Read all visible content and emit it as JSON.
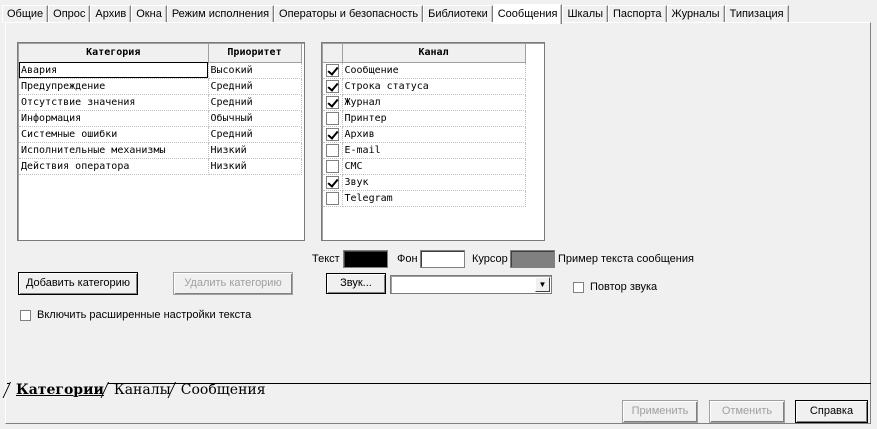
{
  "top_tabs": [
    "Общие",
    "Опрос",
    "Архив",
    "Окна",
    "Режим исполнения",
    "Операторы и безопасность",
    "Библиотеки",
    "Сообщения",
    "Шкалы",
    "Паспорта",
    "Журналы",
    "Типизация"
  ],
  "active_tab_index": 7,
  "category_grid": {
    "headers": {
      "category": "Категория",
      "priority": "Приоритет"
    },
    "rows": [
      {
        "category": "Авария",
        "priority": "Высокий"
      },
      {
        "category": "Предупреждение",
        "priority": "Средний"
      },
      {
        "category": "Отсутствие значения",
        "priority": "Средний"
      },
      {
        "category": "Информация",
        "priority": "Обычный"
      },
      {
        "category": "Системные ошибки",
        "priority": "Средний"
      },
      {
        "category": "Исполнительные механизмы",
        "priority": "Низкий"
      },
      {
        "category": "Действия оператора",
        "priority": "Низкий"
      }
    ]
  },
  "channel_grid": {
    "header": "Канал",
    "rows": [
      {
        "name": "Сообщение",
        "checked": true
      },
      {
        "name": "Строка статуса",
        "checked": true
      },
      {
        "name": "Журнал",
        "checked": true
      },
      {
        "name": "Принтер",
        "checked": false
      },
      {
        "name": "Архив",
        "checked": true
      },
      {
        "name": "E-mail",
        "checked": false
      },
      {
        "name": "СМС",
        "checked": false
      },
      {
        "name": "Звук",
        "checked": true
      },
      {
        "name": "Telegram",
        "checked": false
      }
    ]
  },
  "colors": {
    "text_label": "Текст",
    "text_color": "#000000",
    "bg_label": "Фон",
    "bg_color": "#ffffff",
    "cursor_label": "Курсор",
    "cursor_color": "#808080",
    "sample_text": "Пример текста сообщения"
  },
  "buttons": {
    "add_category": "Добавить категорию",
    "delete_category": "Удалить категорию",
    "sound": "Звук...",
    "apply": "Применить",
    "cancel": "Отменить",
    "help": "Справка"
  },
  "sound_combo_value": "",
  "repeat_sound": {
    "label": "Повтор звука",
    "checked": false
  },
  "extended_text": {
    "label": "Включить расширенные настройки текста",
    "checked": false
  },
  "bottom_tabs": [
    "Категории",
    "Каналы",
    "Сообщения"
  ],
  "active_bottom_tab_index": 0
}
